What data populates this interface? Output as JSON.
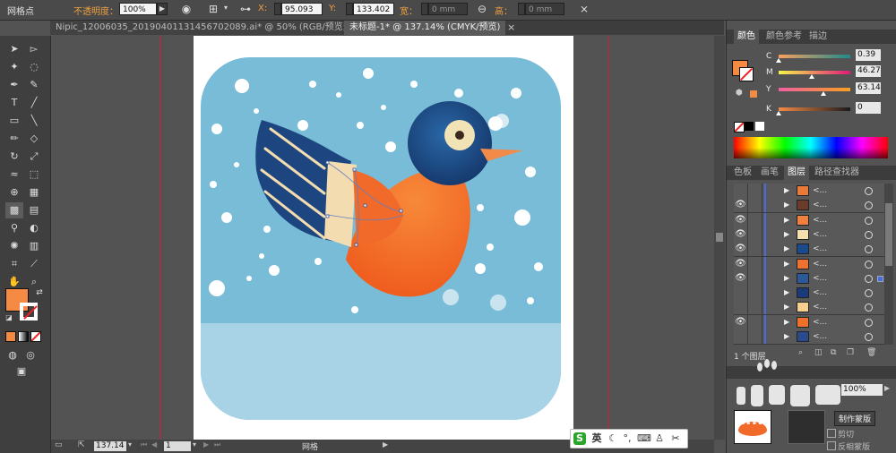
{
  "control_bar": {
    "mode_label": "网格点",
    "opacity_label": "不透明度：",
    "opacity_value": "100%",
    "x_label": "X:",
    "x_value": "95.093",
    "y_label": "Y:",
    "y_value": "133.402",
    "width_label": "宽：",
    "width_value": "0 mm",
    "height_label": "高：",
    "height_value": "0 mm"
  },
  "tabs": [
    {
      "label": "Nipic_12006035_20190401131456702089.ai* @ 50% (RGB/预览)",
      "active": false
    },
    {
      "label": "未标题-1* @ 137.14% (CMYK/预览)",
      "active": true
    }
  ],
  "status_bar": {
    "zoom": "137.14",
    "artboard": "1",
    "info": "网格"
  },
  "color_panel": {
    "tabs": [
      "颜色",
      "颜色参考",
      "描边"
    ],
    "channels": [
      {
        "label": "C",
        "value": "0.39",
        "pos": 0.004
      },
      {
        "label": "M",
        "value": "46.27",
        "pos": 0.46
      },
      {
        "label": "Y",
        "value": "63.14",
        "pos": 0.63
      },
      {
        "label": "K",
        "value": "0",
        "pos": 0.0
      }
    ],
    "fill_color": "#f58a45"
  },
  "layers_panel": {
    "tabs": [
      "色板",
      "画笔",
      "图层",
      "路径查找器"
    ],
    "footer_text": "1 个图层",
    "rows": [
      {
        "name": "<...",
        "visible": false,
        "thumb": "#e87a3a"
      },
      {
        "name": "<...",
        "visible": true,
        "thumb": "#6a3a2a"
      },
      {
        "name": "<...",
        "visible": true,
        "thumb": "#f08040"
      },
      {
        "name": "<...",
        "visible": true,
        "thumb": "#f5e0b0"
      },
      {
        "name": "<...",
        "visible": true,
        "thumb": "#1a4a8a"
      },
      {
        "name": "<...",
        "visible": true,
        "thumb": "#f07030"
      },
      {
        "name": "<...",
        "visible": true,
        "thumb": "#2a5a9a"
      },
      {
        "name": "<...",
        "visible": false,
        "thumb": "#1a3a7a"
      },
      {
        "name": "<...",
        "visible": false,
        "thumb": "#f5d090"
      },
      {
        "name": "<...",
        "visible": true,
        "thumb": "#f07030"
      },
      {
        "name": "<...",
        "visible": false,
        "thumb": "#2a4a8a"
      }
    ]
  },
  "transparency_panel": {
    "opacity_value": "100%",
    "mask_button": "制作蒙版",
    "invert_label": "反相蒙版",
    "clip_label": "剪切"
  },
  "ime": {
    "logo": "S",
    "mode": "英"
  },
  "colors": {
    "sky": "#79bcd8",
    "ground": "#a8d3e6",
    "bird_body": "#f26a2a",
    "bird_head": "#1f4f86",
    "wing_dark": "#1d4680",
    "beak": "#f28a4a",
    "eye": "#f2e3b6"
  }
}
